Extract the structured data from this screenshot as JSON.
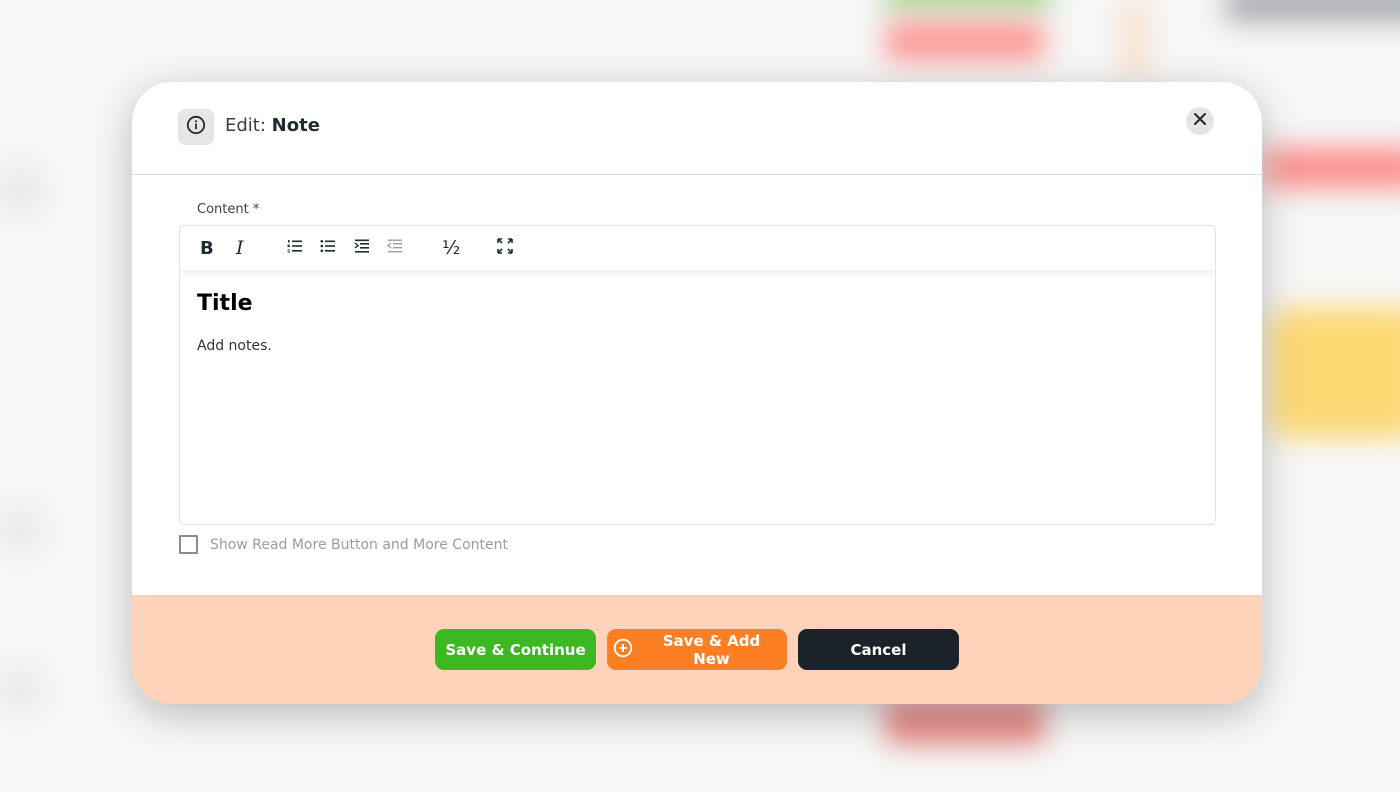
{
  "modal": {
    "title_prefix": "Edit:",
    "title_entity": "Note",
    "info_icon": "info-circle-icon",
    "close_icon": "close-x-icon"
  },
  "form": {
    "content_label": "Content *",
    "toolbar": [
      {
        "name": "bold",
        "glyph": "B"
      },
      {
        "name": "italic",
        "glyph": "I"
      },
      {
        "name": "ordered-list",
        "icon": "ordered-list-icon"
      },
      {
        "name": "bullet-list",
        "icon": "bullet-list-icon"
      },
      {
        "name": "indent",
        "icon": "indent-icon"
      },
      {
        "name": "outdent",
        "icon": "outdent-icon",
        "disabled": true
      },
      {
        "name": "fraction",
        "glyph": "½"
      },
      {
        "name": "fullscreen",
        "icon": "fullscreen-icon"
      }
    ],
    "editor_content": {
      "heading": "Title",
      "paragraph": "Add notes."
    },
    "read_more_checkbox": {
      "label": "Show Read More Button and More Content",
      "checked": false
    }
  },
  "footer": {
    "save_continue_label": "Save & Continue",
    "save_add_new_label": "Save & Add New",
    "cancel_label": "Cancel"
  },
  "colors": {
    "save_continue": "#3cb821",
    "save_add_new": "#fd7f23",
    "cancel": "#1c2229",
    "footer_bg": "#fed3b9"
  }
}
